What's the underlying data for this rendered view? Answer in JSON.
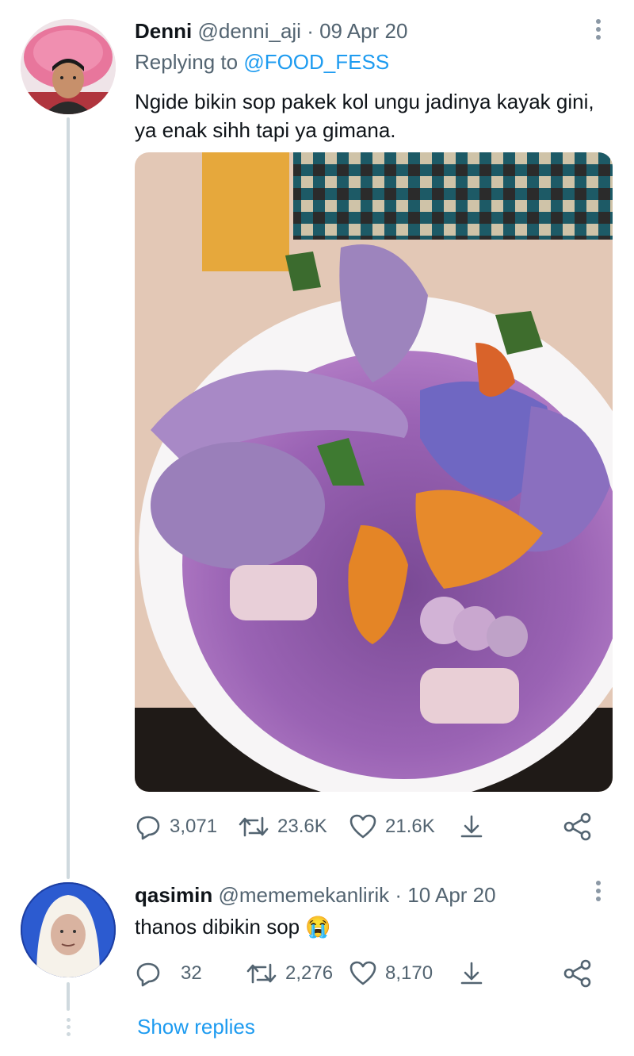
{
  "tweet": {
    "display_name": "Denni",
    "handle": "@denni_aji",
    "separator": "·",
    "date": "09 Apr 20",
    "replying_prefix": "Replying to",
    "replying_handle": "@FOOD_FESS",
    "text": "Ngide bikin sop pakek kol ungu jadinya kayak gini, ya enak sihh tapi ya gimana.",
    "replies": "3,071",
    "retweets": "23.6K",
    "likes": "21.6K"
  },
  "reply": {
    "display_name": "qasimin",
    "handle": "@mememekanlirik",
    "separator": "·",
    "date": "10 Apr 20",
    "text": "thanos dibikin sop",
    "emoji": "😭",
    "replies": "32",
    "retweets": "2,276",
    "likes": "8,170"
  },
  "show_replies_label": "Show replies",
  "colors": {
    "accent": "#1d9bf0",
    "muted": "#536471",
    "thread_line": "#cfd9de",
    "soup": "#8e5aa6"
  },
  "icons": [
    "reply-icon",
    "retweet-icon",
    "like-icon",
    "share-icon",
    "more-icon"
  ]
}
